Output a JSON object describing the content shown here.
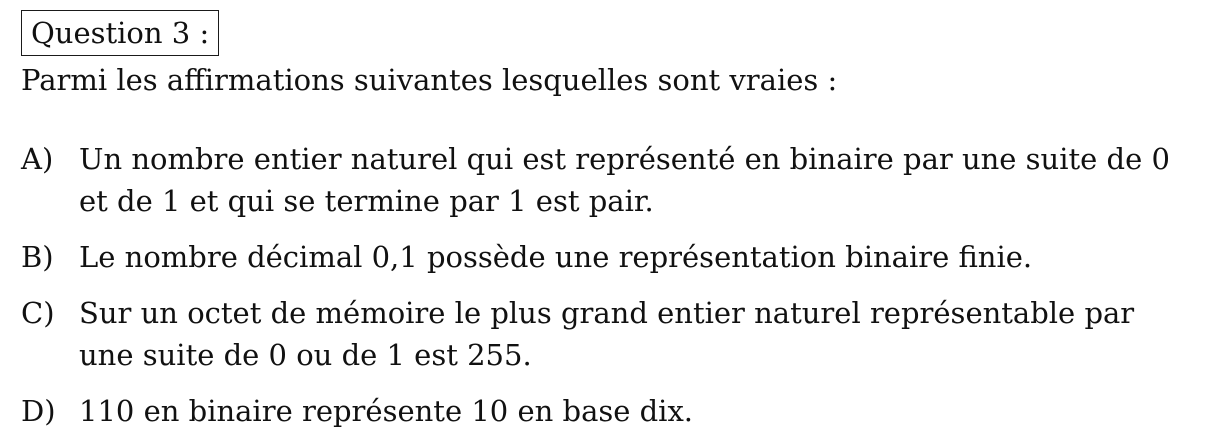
{
  "question": {
    "label": "Question 3 :",
    "intro": "Parmi les affirmations suivantes lesquelles sont vraies :"
  },
  "answers": [
    {
      "letter": "A)",
      "text": "Un nombre entier naturel qui est représenté en binaire par une suite de 0 et de 1 et qui se termine par 1 est pair."
    },
    {
      "letter": "B)",
      "text": "Le nombre décimal 0,1 possède une représentation binaire finie."
    },
    {
      "letter": "C)",
      "text": "Sur un octet de mémoire le plus grand entier naturel représentable par une suite de 0 ou de 1 est 255."
    },
    {
      "letter": "D)",
      "text": "110 en binaire représente 10 en base dix."
    }
  ]
}
